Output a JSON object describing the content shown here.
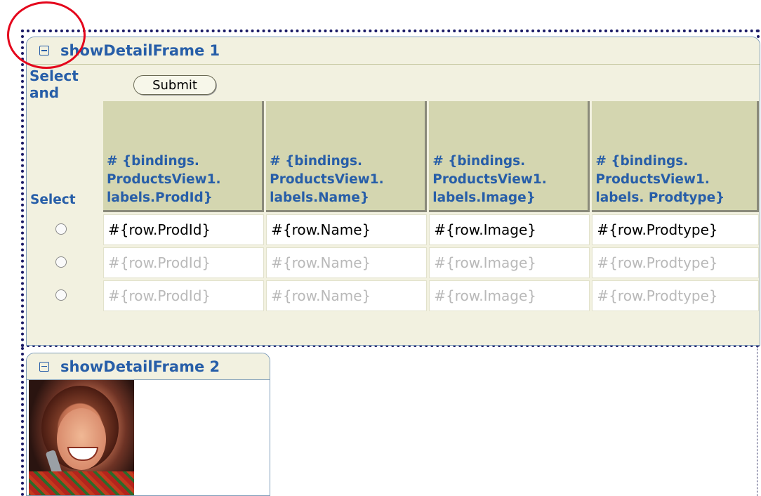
{
  "frame1": {
    "title": "showDetailFrame 1",
    "toolbar_label": "Select and",
    "submit_label": "Submit",
    "table": {
      "select_header": "Select",
      "headers": [
        "# {bindings. ProductsView1. labels.ProdId}",
        "# {bindings. ProductsView1. labels.Name}",
        "# {bindings. ProductsView1. labels.Image}",
        "# {bindings. ProductsView1. labels. Prodtype}"
      ],
      "rows": [
        [
          "#{row.ProdId}",
          "#{row.Name}",
          "#{row.Image}",
          "#{row.Prodtype}"
        ],
        [
          "#{row.ProdId}",
          "#{row.Name}",
          "#{row.Image}",
          "#{row.Prodtype}"
        ],
        [
          "#{row.ProdId}",
          "#{row.Name}",
          "#{row.Image}",
          "#{row.Prodtype}"
        ]
      ]
    }
  },
  "frame2": {
    "title": "showDetailFrame 2"
  },
  "colors": {
    "accent": "#275ea8",
    "annotation": "#e4061c",
    "header_bg": "#d4d6b0",
    "panel_bg": "#f2f1e0"
  },
  "icons": [
    "collapse-toggle-icon",
    "radio-icon"
  ]
}
